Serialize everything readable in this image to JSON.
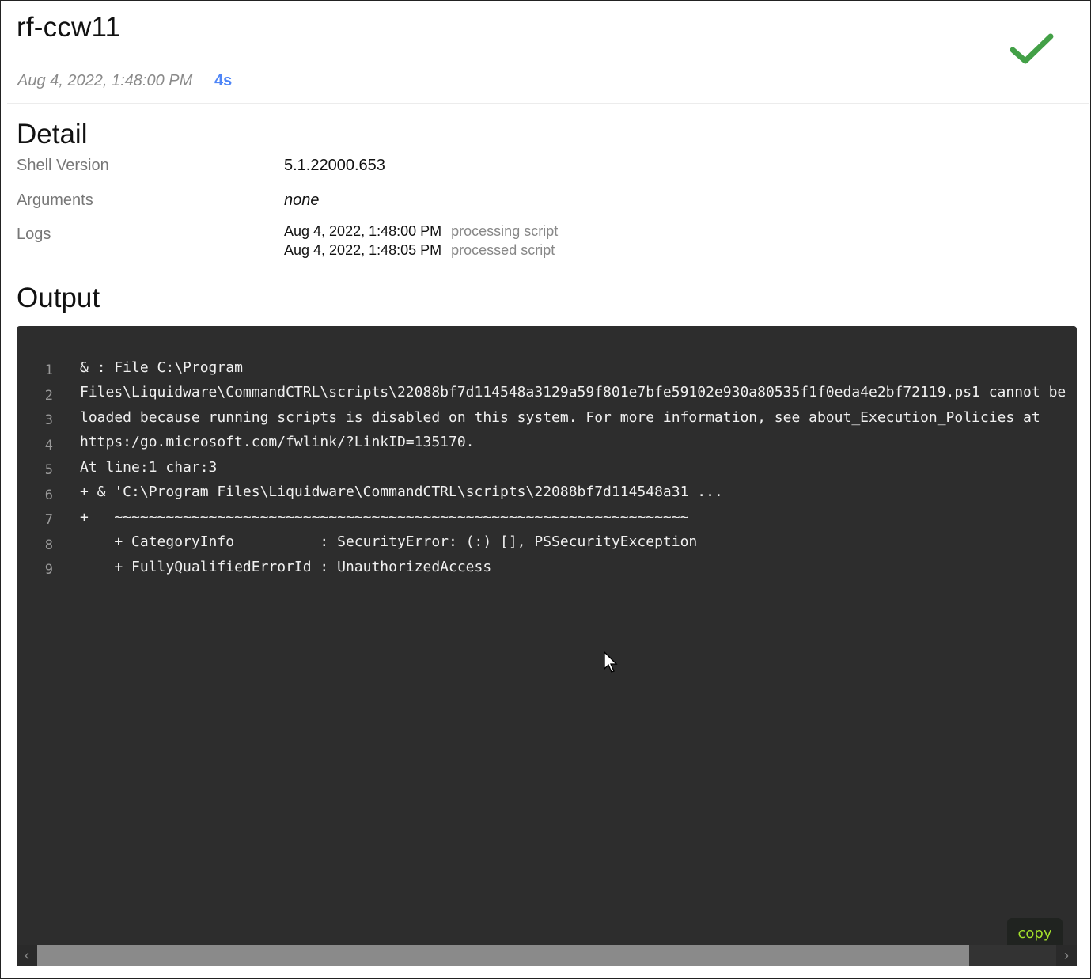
{
  "header": {
    "title": "rf-ccw11",
    "timestamp": "Aug 4, 2022, 1:48:00 PM",
    "duration": "4s",
    "status_icon": "check-icon",
    "status_color": "#43a047"
  },
  "detail": {
    "section_title": "Detail",
    "shell_version_label": "Shell Version",
    "shell_version_value": "5.1.22000.653",
    "arguments_label": "Arguments",
    "arguments_value": "none",
    "logs_label": "Logs",
    "logs": [
      {
        "time": "Aug 4, 2022, 1:48:00 PM",
        "message": "processing script"
      },
      {
        "time": "Aug 4, 2022, 1:48:05 PM",
        "message": "processed script"
      }
    ]
  },
  "output": {
    "section_title": "Output",
    "line_numbers": [
      "1",
      "2",
      "3",
      "4",
      "5",
      "6",
      "7",
      "8",
      "9"
    ],
    "lines": [
      "& : File C:\\Program",
      "Files\\Liquidware\\CommandCTRL\\scripts\\22088bf7d114548a3129a59f801e7bfe59102e930a80535f1f0eda4e2bf72119.ps1 cannot be",
      "loaded because running scripts is disabled on this system. For more information, see about_Execution_Policies at",
      "https:/go.microsoft.com/fwlink/?LinkID=135170.",
      "At line:1 char:3",
      "+ & 'C:\\Program Files\\Liquidware\\CommandCTRL\\scripts\\22088bf7d114548a31 ...",
      "+   ~~~~~~~~~~~~~~~~~~~~~~~~~~~~~~~~~~~~~~~~~~~~~~~~~~~~~~~~~~~~~~~~~~~",
      "    + CategoryInfo          : SecurityError: (:) [], PSSecurityException",
      "    + FullyQualifiedErrorId : UnauthorizedAccess"
    ],
    "copy_label": "copy",
    "background": "#2d2d2d"
  }
}
